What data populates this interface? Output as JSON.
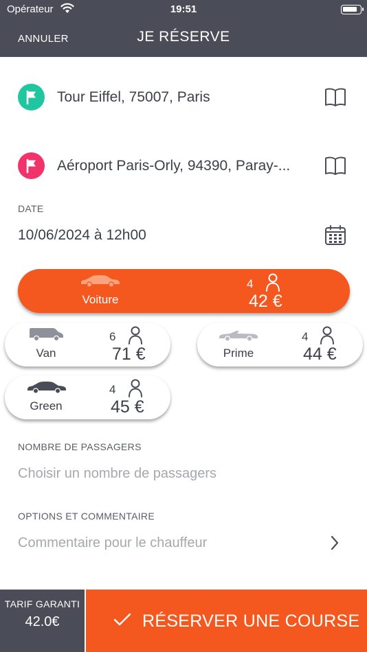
{
  "status_bar": {
    "carrier": "Opérateur",
    "time": "19:51",
    "battery_level": 0.85
  },
  "nav": {
    "cancel_label": "ANNULER",
    "title": "JE RÉSERVE"
  },
  "pickup": {
    "address": "Tour Eiffel, 75007, Paris",
    "color": "#1fc6a0",
    "icon": "flag-icon"
  },
  "dropoff": {
    "address": "Aéroport Paris-Orly, 94390, Paray-...",
    "color": "#f0346b",
    "icon": "flag-icon"
  },
  "date": {
    "label": "DATE",
    "value": "10/06/2024 à 12h00"
  },
  "vehicles": [
    {
      "name": "Voiture",
      "seats": "4",
      "price": "42 €",
      "selected": true
    },
    {
      "name": "Van",
      "seats": "6",
      "price": "71 €",
      "selected": false
    },
    {
      "name": "Prime",
      "seats": "4",
      "price": "44 €",
      "selected": false
    },
    {
      "name": "Green",
      "seats": "4",
      "price": "45 €",
      "selected": false
    }
  ],
  "passengers": {
    "label": "NOMBRE DE PASSAGERS",
    "placeholder": "Choisir un nombre de passagers"
  },
  "options": {
    "label": "OPTIONS ET COMMENTAIRE",
    "placeholder": "Commentaire pour le chauffeur"
  },
  "footer": {
    "tarif_label": "TARIF GARANTI",
    "tarif_value": "42.0€",
    "reserve_label": "RÉSERVER UNE COURSE"
  },
  "colors": {
    "accent": "#f4581f",
    "header": "#4a4c57",
    "text": "#3c4048",
    "placeholder": "#a5a8ae"
  }
}
